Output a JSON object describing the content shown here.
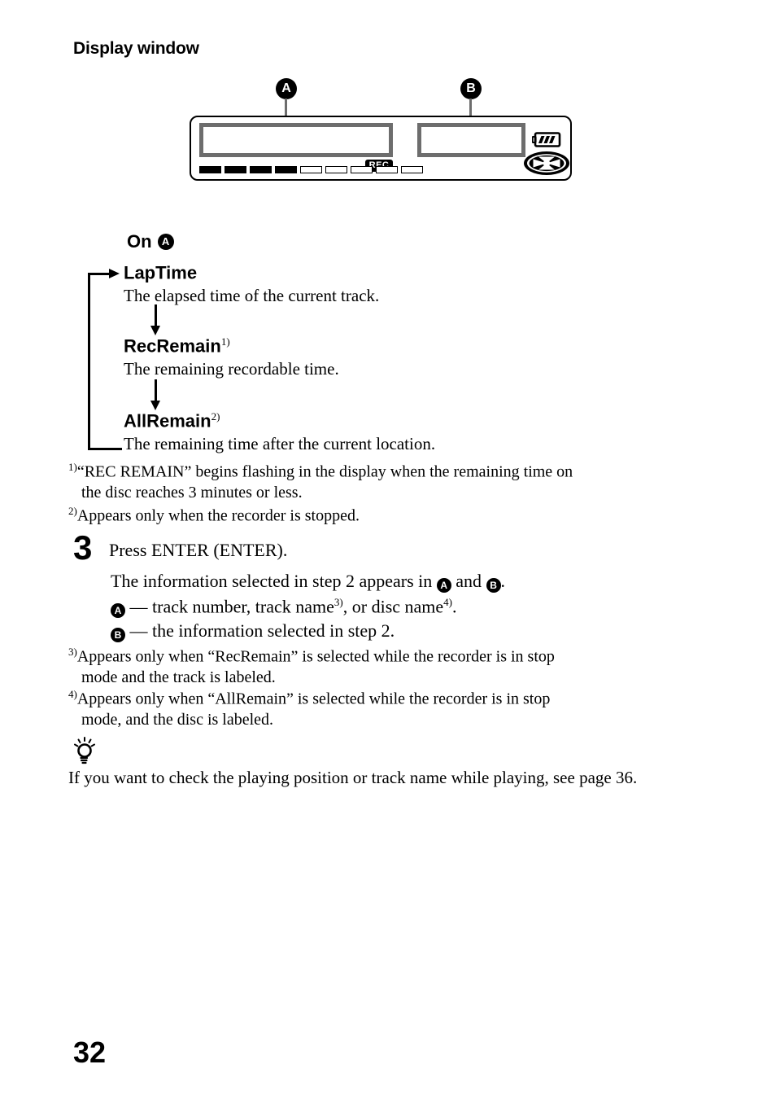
{
  "page": {
    "number": "32",
    "heading": "Display window"
  },
  "diagram": {
    "callout_a": "A",
    "callout_b": "B",
    "rec_label": "REC",
    "battery_icon": "battery-icon",
    "disc_icon": "disc-icon",
    "segments_total": 9,
    "segments_filled": 4
  },
  "on_section": {
    "label": "On",
    "badge": "A"
  },
  "cycle": {
    "items": [
      {
        "term": "LapTime",
        "footnote": "",
        "desc": "The elapsed time of the current track."
      },
      {
        "term": "RecRemain",
        "footnote": "1)",
        "desc": "The remaining recordable time."
      },
      {
        "term": "AllRemain",
        "footnote": "2)",
        "desc": "The remaining time after the current location."
      }
    ]
  },
  "footnotes": {
    "fn1": {
      "marker": "1)",
      "line1": "“REC REMAIN” begins flashing in the display when the remaining time on",
      "line2": "the disc reaches 3 minutes or less."
    },
    "fn2": {
      "marker": "2)",
      "line1": "Appears only when the recorder is stopped.",
      "line2": ""
    },
    "fn3": {
      "marker": "3)",
      "line1": "Appears only when “RecRemain” is selected while the recorder is in stop",
      "line2": "mode and the track is labeled."
    },
    "fn4": {
      "marker": "4)",
      "line1": "Appears only when “AllRemain” is selected while the recorder is in stop",
      "line2": "mode, and the disc is labeled."
    }
  },
  "step": {
    "number": "3",
    "instruction": "Press ENTER (ENTER).",
    "result_pre": "The information selected in step 2 appears in ",
    "result_badge_a": "A",
    "result_mid": " and ",
    "result_badge_b": "B",
    "result_end": ".",
    "line_a_badge": "A",
    "line_a_text_1": " — track number, track name",
    "line_a_sup_1": "3)",
    "line_a_text_2": ", or disc name",
    "line_a_sup_2": "4)",
    "line_a_text_3": ".",
    "line_b_badge": "B",
    "line_b_text": " — the information selected in step 2."
  },
  "tip": {
    "icon": "lightbulb-icon",
    "line1": "If you want to check the playing position or track name while playing, see",
    "line2": "page 36."
  }
}
